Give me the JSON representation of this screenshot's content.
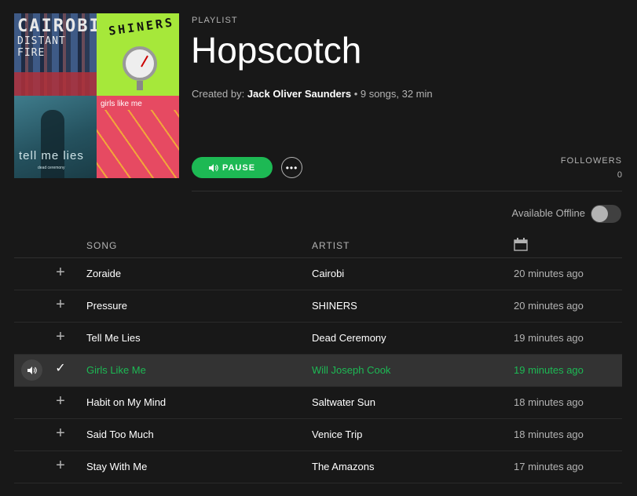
{
  "cover": {
    "tile1_line1": "CAIROBI",
    "tile1_line2": "DISTANT FIRE",
    "tile2_text": "SHINERS",
    "tile3_text": "tell me lies",
    "tile3_sub": "dead ceremony",
    "tile4_text": "girls like me"
  },
  "playlist": {
    "eyebrow": "PLAYLIST",
    "title": "Hopscotch",
    "created_by_label": "Created by: ",
    "owner": "Jack Oliver Saunders",
    "summary": " • 9 songs, 32 min"
  },
  "controls": {
    "pause_label": "PAUSE",
    "more_label": "•••",
    "followers_label": "FOLLOWERS",
    "followers_count": "0",
    "offline_label": "Available Offline",
    "offline_enabled": false
  },
  "table": {
    "headers": {
      "song": "SONG",
      "artist": "ARTIST",
      "date_icon": "calendar-icon"
    },
    "rows": [
      {
        "song": "Zoraide",
        "artist": "Cairobi",
        "added": "20 minutes ago",
        "state": "add"
      },
      {
        "song": "Pressure",
        "artist": "SHINERS",
        "added": "20 minutes ago",
        "state": "add"
      },
      {
        "song": "Tell Me Lies",
        "artist": "Dead Ceremony",
        "added": "19 minutes ago",
        "state": "add"
      },
      {
        "song": "Girls Like Me",
        "artist": "Will Joseph Cook",
        "added": "19 minutes ago",
        "state": "playing"
      },
      {
        "song": "Habit on My Mind",
        "artist": "Saltwater Sun",
        "added": "18 minutes ago",
        "state": "add"
      },
      {
        "song": "Said Too Much",
        "artist": "Venice Trip",
        "added": "18 minutes ago",
        "state": "add"
      },
      {
        "song": "Stay With Me",
        "artist": "The Amazons",
        "added": "17 minutes ago",
        "state": "add"
      }
    ]
  },
  "colors": {
    "accent": "#1db954",
    "background": "#181818",
    "playing_row": "#333333",
    "muted_text": "#b3b3b3"
  }
}
